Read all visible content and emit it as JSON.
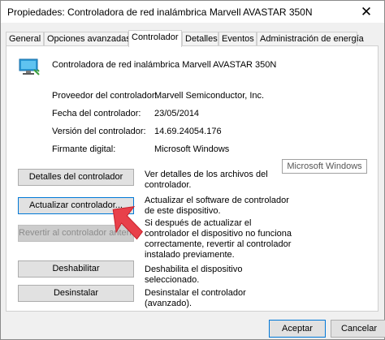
{
  "window": {
    "title": "Propiedades: Controladora de red inalámbrica Marvell AVASTAR 350N",
    "close_glyph": "✕"
  },
  "tabs": [
    {
      "label": "General",
      "active": false
    },
    {
      "label": "Opciones avanzadas",
      "active": false
    },
    {
      "label": "Controlador",
      "active": true
    },
    {
      "label": "Detalles",
      "active": false
    },
    {
      "label": "Eventos",
      "active": false
    },
    {
      "label": "Administración de energía",
      "active": false
    }
  ],
  "device": {
    "icon": "network-adapter-icon",
    "name": "Controladora de red inalámbrica Marvell AVASTAR 350N"
  },
  "properties": [
    {
      "label": "Proveedor del controlador:",
      "value": "Marvell Semiconductor, Inc."
    },
    {
      "label": "Fecha del controlador:",
      "value": "23/05/2014"
    },
    {
      "label": "Versión del controlador:",
      "value": "14.69.24054.176"
    },
    {
      "label": "Firmante digital:",
      "value": "Microsoft Windows"
    }
  ],
  "signer_box": "Microsoft Windows",
  "actions": [
    {
      "button": "Detalles del controlador",
      "description": "Ver detalles de los archivos del controlador.",
      "disabled": false
    },
    {
      "button": "Actualizar controlador...",
      "description": "Actualizar el software de controlador de este dispositivo.",
      "disabled": false
    },
    {
      "button": "Revertir al controlador anterior",
      "description": "Si después de actualizar el controlador el dispositivo no funciona correctamente, revertir al controlador instalado previamente.",
      "disabled": true
    },
    {
      "button": "Deshabilitar",
      "description": "Deshabilita el dispositivo seleccionado.",
      "disabled": false
    },
    {
      "button": "Desinstalar",
      "description": "Desinstalar el controlador (avanzado).",
      "disabled": false
    }
  ],
  "footer": {
    "accept": "Aceptar",
    "cancel": "Cancelar"
  },
  "colors": {
    "accent_border": "#0078d7",
    "arrow": "#e8404a"
  }
}
